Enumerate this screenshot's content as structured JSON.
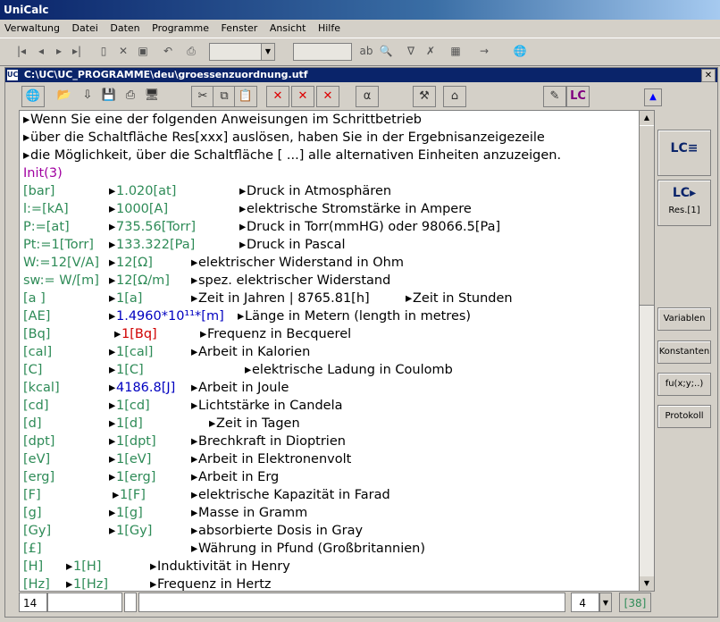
{
  "app": {
    "title": "UniCalc"
  },
  "menu": [
    "Verwaltung",
    "Datei",
    "Daten",
    "Programme",
    "Fenster",
    "Ansicht",
    "Hilfe"
  ],
  "document": {
    "path": "C:\\UC\\UC_PROGRAMME\\deu\\groessenzuordnung.utf"
  },
  "sidebar": {
    "res_label": "Res.[1]",
    "variablen": "Variablen",
    "konstanten": "Konstanten",
    "fu": "fu(x;y;..)",
    "protokoll": "Protokoll"
  },
  "status": {
    "line_no": "14",
    "combo_value": "4",
    "count": "[38]"
  },
  "intro": [
    "Wenn Sie eine der folgenden Anweisungen im Schrittbetrieb",
    "über die Schaltfläche Res[xxx] auslösen, haben Sie in der Ergebnisanzeigezeile",
    "die Möglichkeit, über die Schaltfläche [ ...] alle alternativen Einheiten anzuzeigen."
  ],
  "init_line": "Init(3)",
  "rows": [
    {
      "c1": "[bar]",
      "c2": "1.020[at]",
      "c3": "Druck in Atmosphären"
    },
    {
      "c1": "l:=[kA]",
      "c2": "1000[A]",
      "c3": "elektrische Stromstärke in Ampere"
    },
    {
      "c1": "P:=[at]",
      "c2": "735.56[Torr]",
      "c3": "Druck in Torr(mmHG) oder  98066.5[Pa]"
    },
    {
      "c1": "Pt:=1[Torr]",
      "c2": "133.322[Pa]",
      "c3": "Druck in Pascal"
    },
    {
      "c1": "W:=12[V/A]",
      "c2": "12[Ω]",
      "c3": "elektrischer Widerstand in Ohm"
    },
    {
      "c1": "sw:= W/[m]",
      "c2": "12[Ω/m]",
      "c3": "spez. elektrischer Widerstand"
    },
    {
      "c1": "[a ]",
      "c2": "1[a]",
      "c3": "Zeit in Jahren  |  8765.81[h]",
      "c4": "Zeit in Stunden"
    },
    {
      "c1": "[AE]",
      "c2": "1.4960*10¹¹*[m]",
      "c3": "Länge in Metern (length in metres)"
    },
    {
      "c1": "[Bq]",
      "c2": "1[Bq]",
      "c3": "Frequenz in Becquerel"
    },
    {
      "c1": "[cal]",
      "c2": "1[cal]",
      "c3": "Arbeit in Kalorien"
    },
    {
      "c1": "[C]",
      "c2": "1[C]",
      "c3": "elektrische Ladung in Coulomb"
    },
    {
      "c1": "[kcal]",
      "c2": "4186.8[J]",
      "c3": "Arbeit in Joule"
    },
    {
      "c1": "[cd]",
      "c2": "1[cd]",
      "c3": "Lichtstärke in Candela"
    },
    {
      "c1": "[d]",
      "c2": "1[d]",
      "c3": "Zeit in Tagen"
    },
    {
      "c1": "[dpt]",
      "c2": "1[dpt]",
      "c3": "Brechkraft in Dioptrien"
    },
    {
      "c1": "[eV]",
      "c2": "1[eV]",
      "c3": "Arbeit in Elektronenvolt"
    },
    {
      "c1": "[erg]",
      "c2": "1[erg]",
      "c3": "Arbeit in Erg"
    },
    {
      "c1": "[F]",
      "c2": "1[F]",
      "c3": "elektrische Kapazität in Farad"
    },
    {
      "c1": "[g]",
      "c2": "1[g]",
      "c3": "Masse in Gramm"
    },
    {
      "c1": "[Gy]",
      "c2": "1[Gy]",
      "c3": "absorbierte Dosis in Gray"
    },
    {
      "c1": "[£]",
      "c2": "",
      "c3": "Währung in Pfund (Großbritannien)"
    },
    {
      "c1": "[H]",
      "c2": "1[H]",
      "c3": "Induktivität in Henry"
    },
    {
      "c1": "[Hz]",
      "c2": "1[Hz]",
      "c3": "Frequenz in Hertz"
    }
  ]
}
